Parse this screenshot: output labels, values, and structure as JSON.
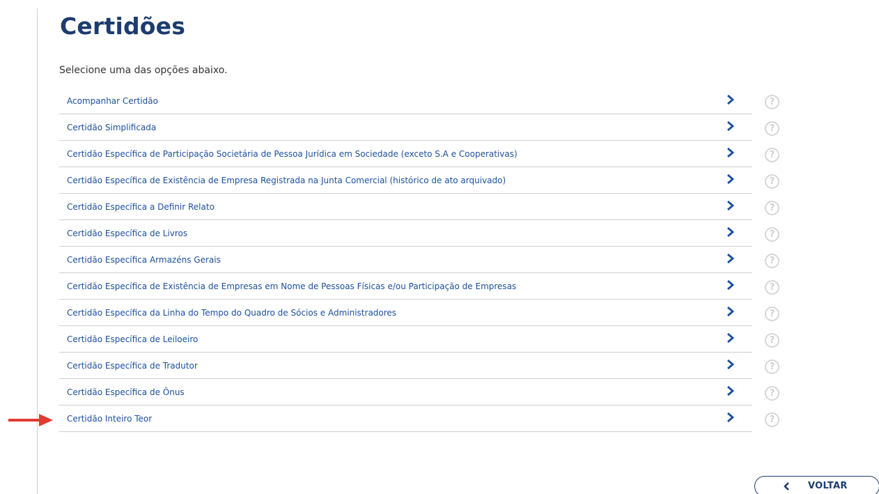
{
  "page": {
    "title": "Certidões",
    "subtitle": "Selecione uma das opções abaixo."
  },
  "options": [
    {
      "label": "Acompanhar Certidão"
    },
    {
      "label": "Certidão Simplificada"
    },
    {
      "label": "Certidão Específica de Participação Societária de Pessoa Jurídica em Sociedade (exceto S.A e Cooperativas)"
    },
    {
      "label": "Certidão Específica de Existência de Empresa Registrada na Junta Comercial (histórico de ato arquivado)"
    },
    {
      "label": "Certidão Específica a Definir Relato"
    },
    {
      "label": "Certidão Específica de Livros"
    },
    {
      "label": "Certidão Específica Armazéns Gerais"
    },
    {
      "label": "Certidão Específica de Existência de Empresas em Nome de Pessoas Físicas e/ou Participação de Empresas"
    },
    {
      "label": "Certidão Específica da Linha do Tempo do Quadro de Sócios e Administradores"
    },
    {
      "label": "Certidão Específica de Leiloeiro"
    },
    {
      "label": "Certidão Específica de Tradutor"
    },
    {
      "label": "Certidão Específica de Ônus"
    },
    {
      "label": "Certidão Inteiro Teor"
    }
  ],
  "help_glyph": "?",
  "back_button": {
    "label": "VOLTAR"
  },
  "colors": {
    "title": "#1c3c6e",
    "link": "#1b4f9c",
    "chevron": "#1b4f9c",
    "help": "#d0d0d0",
    "annotation_arrow": "#e03c31"
  },
  "icons": {
    "row_chevron": "chevron-right-icon",
    "help": "help-icon",
    "back": "chevron-left-icon",
    "annotation": "annotation-arrow-icon"
  }
}
